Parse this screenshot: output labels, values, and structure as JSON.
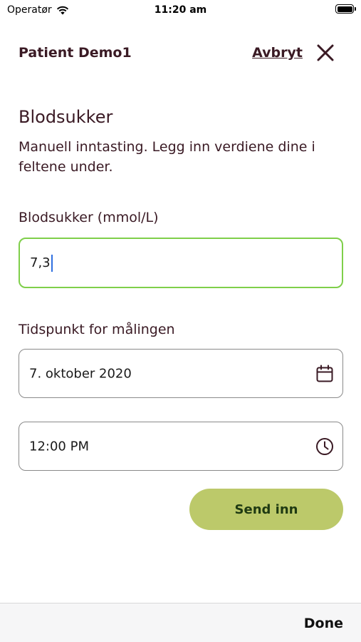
{
  "status_bar": {
    "carrier": "Operatør",
    "time": "11:20 am",
    "wifi_icon": "wifi-icon",
    "battery_icon": "battery-icon"
  },
  "header": {
    "patient": "Patient Demo1",
    "cancel_label": "Avbryt",
    "close_icon": "close-icon"
  },
  "form": {
    "title": "Blodsukker",
    "description": "Manuell inntasting. Legg inn verdiene dine i feltene under.",
    "glucose_label": "Blodsukker (mmol/L)",
    "glucose_value": "7,3",
    "time_label": "Tidspunkt for målingen",
    "date_value": "7. oktober 2020",
    "date_icon": "calendar-icon",
    "time_value": "12:00 PM",
    "time_icon": "clock-icon",
    "submit_label": "Send inn"
  },
  "keyboard_toolbar": {
    "done_label": "Done"
  },
  "colors": {
    "text": "#3a1a24",
    "active_border": "#7fcf4a",
    "submit_button": "#bcc96a",
    "caret": "#2f6fe0"
  }
}
